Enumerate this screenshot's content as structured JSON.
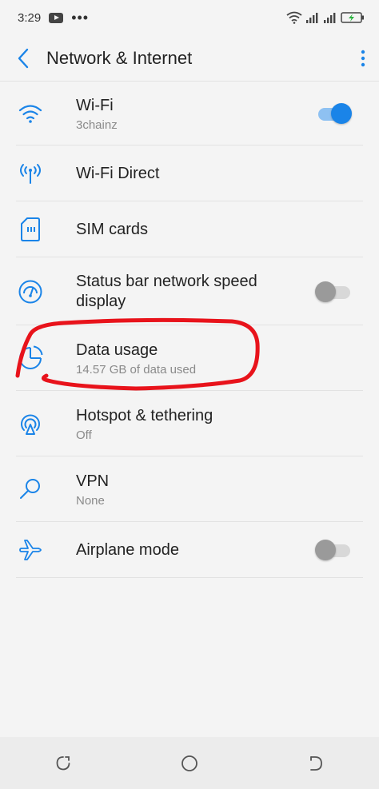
{
  "status_bar": {
    "time": "3:29",
    "icons": [
      "youtube-icon",
      "more-dots-icon",
      "wifi-icon",
      "signal-icon",
      "signal-icon",
      "battery-charging-icon"
    ]
  },
  "app_bar": {
    "title": "Network & Internet",
    "back_icon": "back-arrow-icon",
    "menu_icon": "more-vert-icon"
  },
  "settings": [
    {
      "id": "wifi",
      "label": "Wi-Fi",
      "sub": "3chainz",
      "icon": "wifi-icon",
      "toggle": "on"
    },
    {
      "id": "wifi-direct",
      "label": "Wi-Fi Direct",
      "sub": "",
      "icon": "wifi-direct-icon",
      "toggle": null
    },
    {
      "id": "sim",
      "label": "SIM cards",
      "sub": "",
      "icon": "sim-card-icon",
      "toggle": null
    },
    {
      "id": "netspeed",
      "label": "Status bar network speed display",
      "sub": "",
      "icon": "speedometer-icon",
      "toggle": "off"
    },
    {
      "id": "data",
      "label": "Data usage",
      "sub": "14.57 GB of data used",
      "icon": "data-usage-icon",
      "toggle": null
    },
    {
      "id": "hotspot",
      "label": "Hotspot & tethering",
      "sub": "Off",
      "icon": "hotspot-icon",
      "toggle": null
    },
    {
      "id": "vpn",
      "label": "VPN",
      "sub": "None",
      "icon": "vpn-key-icon",
      "toggle": null
    },
    {
      "id": "airplane",
      "label": "Airplane mode",
      "sub": "",
      "icon": "airplane-icon",
      "toggle": "off"
    }
  ],
  "nav_bar": {
    "icons": [
      "recents-icon",
      "home-icon",
      "back-icon"
    ]
  },
  "colors": {
    "accent": "#1a84e8",
    "annotation": "#e8131b"
  }
}
